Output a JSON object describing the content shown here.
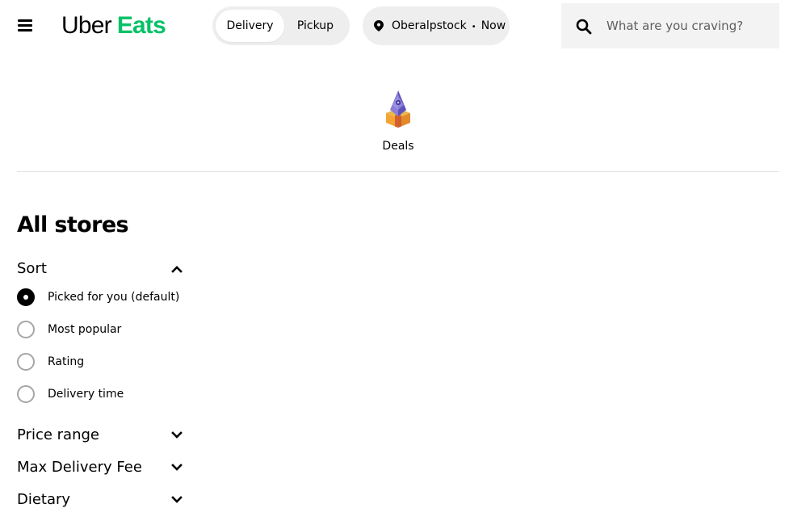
{
  "header": {
    "logo_primary": "Uber",
    "logo_secondary": "Eats",
    "logo_color": "#06c167",
    "modes": [
      {
        "label": "Delivery",
        "selected": true
      },
      {
        "label": "Pickup",
        "selected": false
      }
    ],
    "location": {
      "place": "Oberalpstock",
      "separator": "•",
      "time": "Now"
    },
    "search": {
      "placeholder": "What are you craving?",
      "value": ""
    }
  },
  "categories": [
    {
      "label": "Deals",
      "icon": "deals-icon"
    }
  ],
  "main": {
    "title": "All stores",
    "sort": {
      "title": "Sort",
      "expanded": true,
      "options": [
        {
          "label": "Picked for you (default)",
          "selected": true
        },
        {
          "label": "Most popular",
          "selected": false
        },
        {
          "label": "Rating",
          "selected": false
        },
        {
          "label": "Delivery time",
          "selected": false
        }
      ]
    },
    "filters": [
      {
        "title": "Price range",
        "expanded": false
      },
      {
        "title": "Max Delivery Fee",
        "expanded": false
      },
      {
        "title": "Dietary",
        "expanded": false
      }
    ]
  }
}
